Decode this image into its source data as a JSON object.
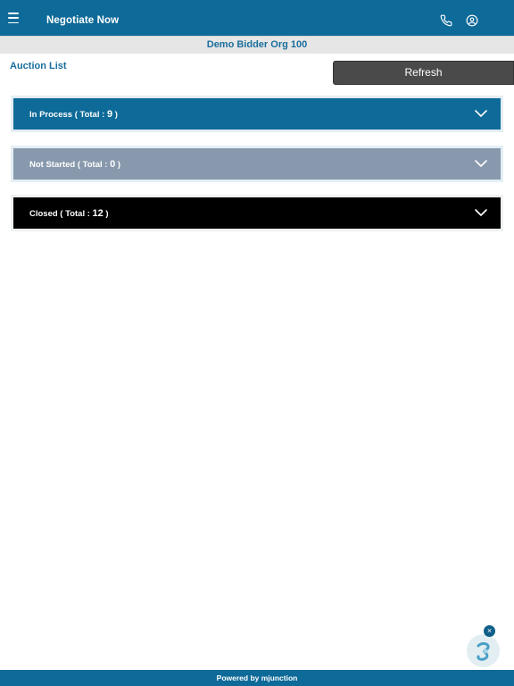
{
  "header": {
    "title": "Negotiate Now",
    "menu_icon": "hamburger-menu-icon",
    "phone_icon": "phone-icon",
    "profile_icon": "user-circle-icon"
  },
  "org_bar": {
    "name": "Demo Bidder Org 100"
  },
  "main": {
    "section_title": "Auction List",
    "refresh_label": "Refresh",
    "accordions": [
      {
        "label": "In Process ( Total : ",
        "count": "9",
        "suffix": " )",
        "color": "#0e6a98",
        "icon": "chevron-down-icon"
      },
      {
        "label": "Not Started ( Total : ",
        "count": "0",
        "suffix": " )",
        "color": "#8899ad",
        "icon": "chevron-down-icon"
      },
      {
        "label": "Closed ( Total : ",
        "count": "12",
        "suffix": " )",
        "color": "#000000",
        "icon": "chevron-down-icon"
      }
    ]
  },
  "chat_widget": {
    "close_label": "×",
    "icon": "chatbot-icon"
  },
  "footer": {
    "text": "Powered by mjunction"
  },
  "colors": {
    "primary": "#0e6a98",
    "org_text": "#1a6e9c",
    "refresh_bg": "#4a4a4a"
  }
}
